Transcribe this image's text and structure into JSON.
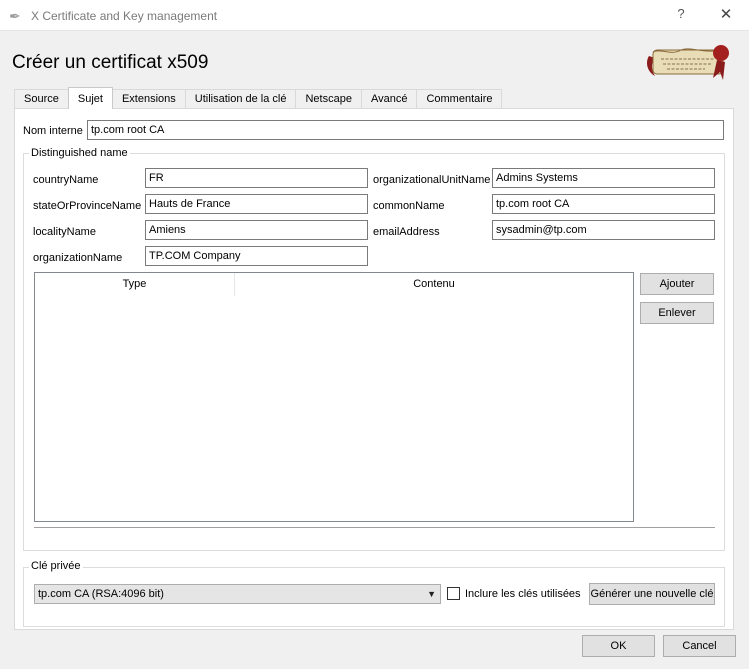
{
  "window": {
    "title": "X Certificate and Key management",
    "help_label": "?",
    "close_label": "✕"
  },
  "heading": "Créer un certificat x509",
  "tabs": [
    {
      "label": "Source"
    },
    {
      "label": "Sujet",
      "active": true
    },
    {
      "label": "Extensions"
    },
    {
      "label": "Utilisation de la clé"
    },
    {
      "label": "Netscape"
    },
    {
      "label": "Avancé"
    },
    {
      "label": "Commentaire"
    }
  ],
  "internal_name": {
    "label": "Nom interne",
    "value": "tp.com root CA"
  },
  "distinguished_name": {
    "title": "Distinguished name",
    "country": {
      "label": "countryName",
      "value": "FR"
    },
    "state": {
      "label": "stateOrProvinceName",
      "value": "Hauts de France"
    },
    "locality": {
      "label": "localityName",
      "value": "Amiens"
    },
    "organization": {
      "label": "organizationName",
      "value": "TP.COM Company"
    },
    "org_unit": {
      "label": "organizationalUnitName",
      "value": "Admins Systems"
    },
    "common_name": {
      "label": "commonName",
      "value": "tp.com root CA"
    },
    "email": {
      "label": "emailAddress",
      "value": "sysadmin@tp.com"
    },
    "table": {
      "columns": [
        "Type",
        "Contenu"
      ],
      "rows": []
    },
    "add_button": "Ajouter",
    "remove_button": "Enlever"
  },
  "private_key": {
    "title": "Clé privée",
    "selected": "tp.com CA (RSA:4096 bit)",
    "include_used_label": "Inclure les clés utilisées",
    "include_used_checked": false,
    "generate_button": "Générer une nouvelle clé"
  },
  "footer": {
    "ok_label": "OK",
    "cancel_label": "Cancel"
  }
}
